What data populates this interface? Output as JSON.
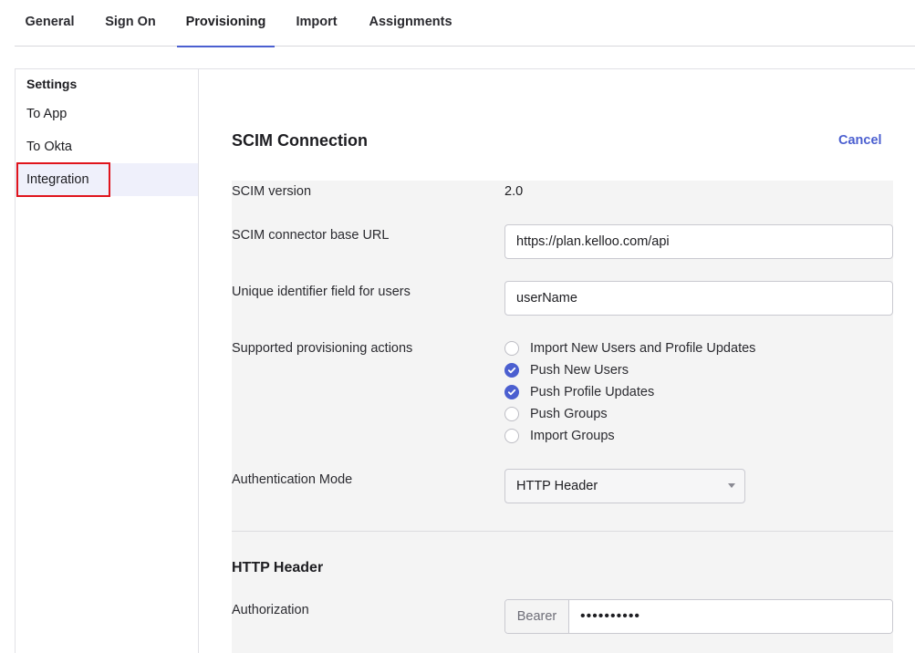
{
  "tabs": [
    {
      "label": "General"
    },
    {
      "label": "Sign On"
    },
    {
      "label": "Provisioning"
    },
    {
      "label": "Import"
    },
    {
      "label": "Assignments"
    }
  ],
  "sidebar": {
    "heading": "Settings",
    "items": [
      {
        "label": "To App"
      },
      {
        "label": "To Okta"
      },
      {
        "label": "Integration"
      }
    ]
  },
  "main": {
    "title": "SCIM Connection",
    "cancel_label": "Cancel",
    "fields": {
      "scim_version": {
        "label": "SCIM version",
        "value": "2.0"
      },
      "base_url": {
        "label": "SCIM connector base URL",
        "value": "https://plan.kelloo.com/api"
      },
      "unique_id": {
        "label": "Unique identifier field for users",
        "value": "userName"
      },
      "provisioning": {
        "label": "Supported provisioning actions",
        "options": [
          {
            "label": "Import New Users and Profile Updates",
            "checked": false
          },
          {
            "label": "Push New Users",
            "checked": true
          },
          {
            "label": "Push Profile Updates",
            "checked": true
          },
          {
            "label": "Push Groups",
            "checked": false
          },
          {
            "label": "Import Groups",
            "checked": false
          }
        ]
      },
      "auth_mode": {
        "label": "Authentication Mode",
        "value": "HTTP Header"
      }
    },
    "http_header": {
      "title": "HTTP Header",
      "authorization": {
        "label": "Authorization",
        "prefix": "Bearer",
        "value": "••••••••••"
      }
    }
  },
  "colors": {
    "accent": "#4b5fd0",
    "highlight": "#e0141c",
    "form_bg": "#f4f4f4"
  }
}
